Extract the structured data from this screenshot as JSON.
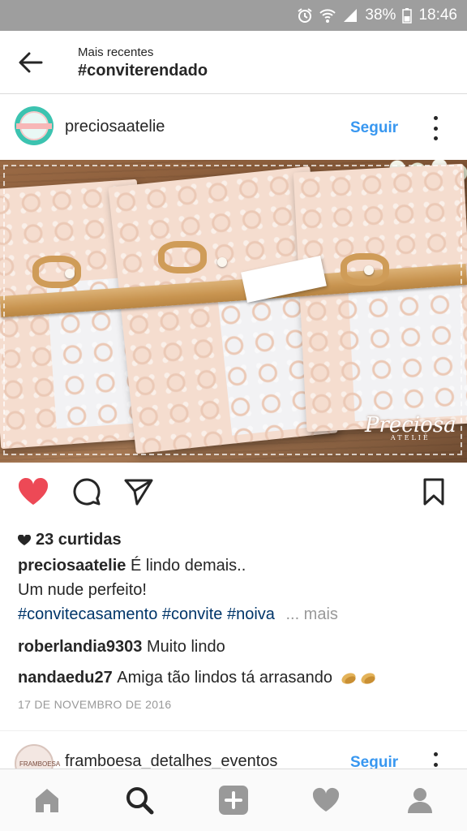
{
  "status_bar": {
    "battery": "38%",
    "time": "18:46"
  },
  "header": {
    "subtitle": "Mais recentes",
    "title": "#conviterendado"
  },
  "post": {
    "username": "preciosaatelie",
    "follow_label": "Seguir",
    "watermark": {
      "brand": "Preciosa",
      "sub": "ATELIÊ"
    },
    "likes_text": "23 curtidas",
    "caption": {
      "user": "preciosaatelie",
      "text": "É lindo demais..",
      "line2": "Um nude perfeito!"
    },
    "hashtags": [
      "#convitecasamento",
      "#convite",
      "#noiva"
    ],
    "more_label": "... mais",
    "comments": [
      {
        "user": "roberlandia9303",
        "text": "Muito lindo"
      },
      {
        "user": "nandaedu27",
        "text": "Amiga tão lindos tá arrasando"
      }
    ],
    "date": "17 DE NOVEMBRO DE 2016",
    "liked": true,
    "like_color": "#ed4956"
  },
  "next_post": {
    "username": "framboesa_detalhes_eventos",
    "follow_label": "Seguir",
    "avatar_text": "FRAMBOESA"
  },
  "nav": {
    "items": [
      "home-icon",
      "search-icon",
      "add-icon",
      "heart-icon",
      "profile-icon"
    ],
    "active": "search-icon"
  },
  "colors": {
    "link": "#3897f0",
    "hashtag": "#003569",
    "status_bar": "#9e9e9e"
  }
}
